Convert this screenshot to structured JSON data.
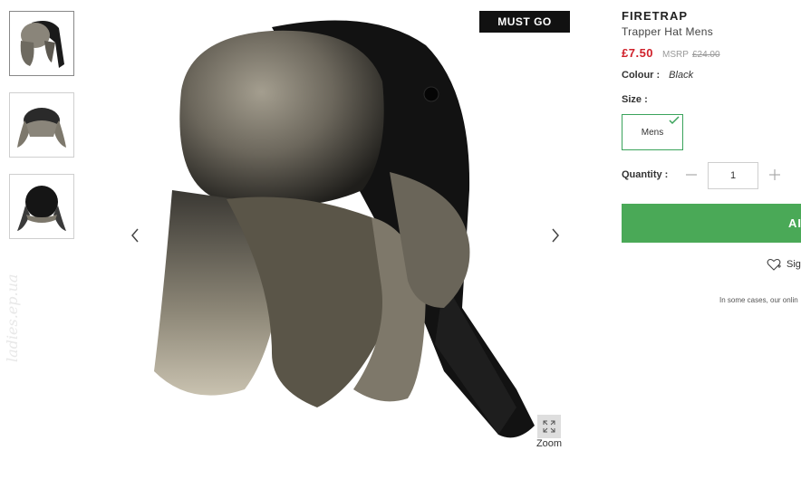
{
  "badge": "MUST GO",
  "product": {
    "brand": "FIRETRAP",
    "name": "Trapper Hat Mens",
    "price": "£7.50",
    "msrp_label": "MSRP",
    "msrp_value": "£24.00",
    "colour_label": "Colour :",
    "colour_value": "Black",
    "size_label": "Size :",
    "size_options": [
      "Mens"
    ],
    "selected_size": "Mens",
    "quantity_label": "Quantity :",
    "quantity_value": "1"
  },
  "actions": {
    "add_to_bag_partial": "AI",
    "wishlist_partial": "Sig"
  },
  "note_partial": "In some cases, our onlin",
  "zoom_label": "Zoom",
  "thumbnails": [
    "front-view",
    "back-view",
    "top-view"
  ],
  "watermark": "ladies.ep.ua",
  "colors": {
    "price": "#d0212b",
    "accent_green": "#4aa957",
    "badge_bg": "#111111"
  }
}
